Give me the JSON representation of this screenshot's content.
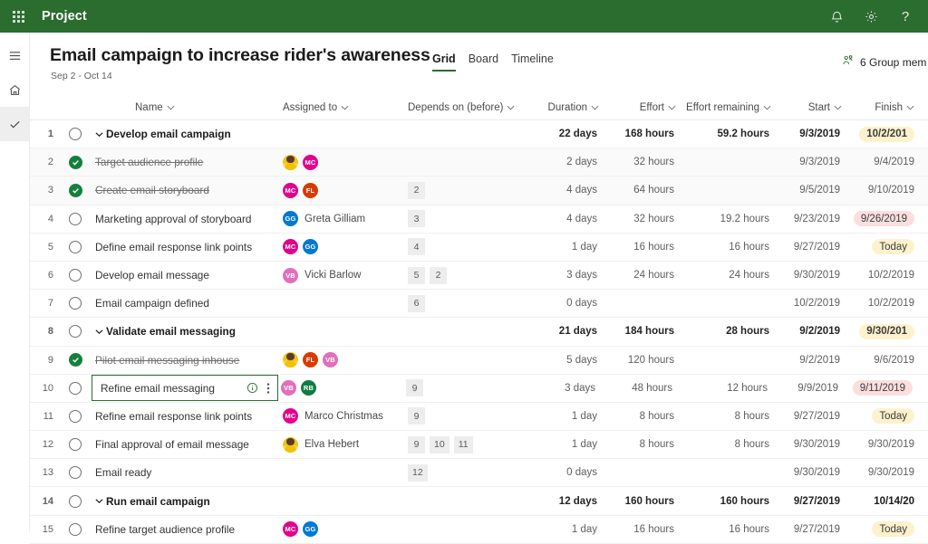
{
  "suite": {
    "waffle_icon": "app-launcher-icon",
    "title": "Project",
    "icons": [
      {
        "name": "notifications-icon",
        "glyph": "bell"
      },
      {
        "name": "settings-icon",
        "glyph": "gear"
      },
      {
        "name": "help-icon",
        "glyph": "?"
      }
    ],
    "accent": "#2b6c2f"
  },
  "rail": {
    "items": [
      {
        "name": "hamburger-menu",
        "glyph": "hamburger",
        "selected": false
      },
      {
        "name": "home",
        "glyph": "home",
        "selected": false
      },
      {
        "name": "tasks",
        "glyph": "check",
        "selected": true
      }
    ]
  },
  "header": {
    "project_title": "Email campaign to increase rider's awareness",
    "date_range": "Sep 2 - Oct 14",
    "tabs": [
      {
        "label": "Grid",
        "active": true
      },
      {
        "label": "Board",
        "active": false
      },
      {
        "label": "Timeline",
        "active": false
      }
    ],
    "group_members": "6 Group mem",
    "group_members_icon": "people-icon"
  },
  "grid": {
    "columns": [
      {
        "key": "name",
        "label": "Name",
        "sortable": true
      },
      {
        "key": "assigned",
        "label": "Assigned to",
        "sortable": true
      },
      {
        "key": "depends",
        "label": "Depends on (before)",
        "sortable": true
      },
      {
        "key": "duration",
        "label": "Duration",
        "sortable": true
      },
      {
        "key": "effort",
        "label": "Effort",
        "sortable": true
      },
      {
        "key": "effort_remaining",
        "label": "Effort remaining",
        "sortable": true
      },
      {
        "key": "start",
        "label": "Start",
        "sortable": true
      },
      {
        "key": "finish",
        "label": "Finish",
        "sortable": true
      }
    ],
    "rows": [
      {
        "index": "1",
        "name": "Develop email campaign",
        "summary": true,
        "done": false,
        "expanded": true,
        "assignees": [],
        "depends": [],
        "duration": "22 days",
        "effort": "168 hours",
        "effort_remaining": "59.2 hours",
        "start": "9/3/2019",
        "finish": "10/2/201",
        "finish_style": "warn",
        "shade": false
      },
      {
        "index": "2",
        "name": "Target audience profile",
        "summary": false,
        "done": true,
        "expanded": false,
        "assignees": [
          {
            "initials": "EH",
            "color": "photo"
          },
          {
            "initials": "MC",
            "color": "#e3008c"
          }
        ],
        "depends": [],
        "duration": "2 days",
        "effort": "32 hours",
        "effort_remaining": "",
        "start": "9/3/2019",
        "finish": "9/4/2019",
        "finish_style": "none",
        "shade": true
      },
      {
        "index": "3",
        "name": "Create email storyboard",
        "summary": false,
        "done": true,
        "expanded": false,
        "assignees": [
          {
            "initials": "MC",
            "color": "#e3008c"
          },
          {
            "initials": "FL",
            "color": "#d83b01"
          }
        ],
        "depends": [
          "2"
        ],
        "duration": "4 days",
        "effort": "64 hours",
        "effort_remaining": "",
        "start": "9/5/2019",
        "finish": "9/10/2019",
        "finish_style": "none",
        "shade": true
      },
      {
        "index": "4",
        "name": "Marketing approval of storyboard",
        "summary": false,
        "done": false,
        "expanded": false,
        "assignees": [
          {
            "initials": "GG",
            "color": "#0078d4",
            "label": "Greta Gilliam"
          }
        ],
        "depends": [
          "3"
        ],
        "duration": "4 days",
        "effort": "32 hours",
        "effort_remaining": "19.2 hours",
        "start": "9/23/2019",
        "finish": "9/26/2019",
        "finish_style": "late",
        "shade": false
      },
      {
        "index": "5",
        "name": "Define email response link points",
        "summary": false,
        "done": false,
        "expanded": false,
        "assignees": [
          {
            "initials": "MC",
            "color": "#e3008c"
          },
          {
            "initials": "GG",
            "color": "#0078d4"
          }
        ],
        "depends": [
          "4"
        ],
        "duration": "1 day",
        "effort": "16 hours",
        "effort_remaining": "16 hours",
        "start": "9/27/2019",
        "finish": "Today",
        "finish_style": "warn",
        "shade": false
      },
      {
        "index": "6",
        "name": "Develop email message",
        "summary": false,
        "done": false,
        "expanded": false,
        "assignees": [
          {
            "initials": "VB",
            "color": "#e06fbc",
            "label": "Vicki Barlow"
          }
        ],
        "depends": [
          "5",
          "2"
        ],
        "duration": "3 days",
        "effort": "24 hours",
        "effort_remaining": "24 hours",
        "start": "9/30/2019",
        "finish": "10/2/2019",
        "finish_style": "none",
        "shade": false
      },
      {
        "index": "7",
        "name": "Email campaign defined",
        "summary": false,
        "done": false,
        "expanded": false,
        "assignees": [],
        "depends": [
          "6"
        ],
        "duration": "0 days",
        "effort": "",
        "effort_remaining": "",
        "start": "10/2/2019",
        "finish": "10/2/2019",
        "finish_style": "none",
        "shade": false
      },
      {
        "index": "8",
        "name": "Validate email messaging",
        "summary": true,
        "done": false,
        "expanded": true,
        "assignees": [],
        "depends": [],
        "duration": "21 days",
        "effort": "184 hours",
        "effort_remaining": "28 hours",
        "start": "9/2/2019",
        "finish": "9/30/201",
        "finish_style": "warn",
        "shade": false
      },
      {
        "index": "9",
        "name": "Pilot email messaging inhouse",
        "summary": false,
        "done": true,
        "expanded": false,
        "assignees": [
          {
            "initials": "EH",
            "color": "photo"
          },
          {
            "initials": "FL",
            "color": "#d83b01"
          },
          {
            "initials": "VB",
            "color": "#e06fbc"
          }
        ],
        "depends": [],
        "duration": "5 days",
        "effort": "120 hours",
        "effort_remaining": "",
        "start": "9/2/2019",
        "finish": "9/6/2019",
        "finish_style": "none",
        "shade": false
      },
      {
        "index": "10",
        "name": "Refine email messaging",
        "summary": false,
        "done": false,
        "expanded": false,
        "selected": true,
        "assignees": [
          {
            "initials": "VB",
            "color": "#e06fbc"
          },
          {
            "initials": "RB",
            "color": "#107c41"
          }
        ],
        "depends": [
          "9"
        ],
        "duration": "3 days",
        "effort": "48 hours",
        "effort_remaining": "12 hours",
        "start": "9/9/2019",
        "finish": "9/11/2019",
        "finish_style": "late",
        "shade": false
      },
      {
        "index": "11",
        "name": "Refine email response link points",
        "summary": false,
        "done": false,
        "expanded": false,
        "assignees": [
          {
            "initials": "MC",
            "color": "#e3008c",
            "label": "Marco Christmas"
          }
        ],
        "depends": [
          "9"
        ],
        "duration": "1 day",
        "effort": "8 hours",
        "effort_remaining": "8 hours",
        "start": "9/27/2019",
        "finish": "Today",
        "finish_style": "warn",
        "shade": false
      },
      {
        "index": "12",
        "name": "Final approval of email message",
        "summary": false,
        "done": false,
        "expanded": false,
        "assignees": [
          {
            "initials": "EH",
            "color": "photo",
            "label": "Elva Hebert"
          }
        ],
        "depends": [
          "9",
          "10",
          "11"
        ],
        "duration": "1 day",
        "effort": "8 hours",
        "effort_remaining": "8 hours",
        "start": "9/30/2019",
        "finish": "9/30/2019",
        "finish_style": "none",
        "shade": false
      },
      {
        "index": "13",
        "name": "Email ready",
        "summary": false,
        "done": false,
        "expanded": false,
        "assignees": [],
        "depends": [
          "12"
        ],
        "duration": "0 days",
        "effort": "",
        "effort_remaining": "",
        "start": "9/30/2019",
        "finish": "9/30/2019",
        "finish_style": "none",
        "shade": false
      },
      {
        "index": "14",
        "name": "Run email campaign",
        "summary": true,
        "done": false,
        "expanded": true,
        "assignees": [],
        "depends": [],
        "duration": "12 days",
        "effort": "160 hours",
        "effort_remaining": "160 hours",
        "start": "9/27/2019",
        "finish": "10/14/20",
        "finish_style": "none",
        "shade": false
      },
      {
        "index": "15",
        "name": "Refine target audience profile",
        "summary": false,
        "done": false,
        "expanded": false,
        "assignees": [
          {
            "initials": "MC",
            "color": "#e3008c"
          },
          {
            "initials": "GG",
            "color": "#0078d4"
          }
        ],
        "depends": [],
        "duration": "1 day",
        "effort": "16 hours",
        "effort_remaining": "16 hours",
        "start": "9/27/2019",
        "finish": "Today",
        "finish_style": "warn",
        "shade": false
      }
    ],
    "selected_cell": {
      "row_index": "10",
      "info_icon": "info-icon",
      "more_icon": "more-options-icon"
    }
  }
}
